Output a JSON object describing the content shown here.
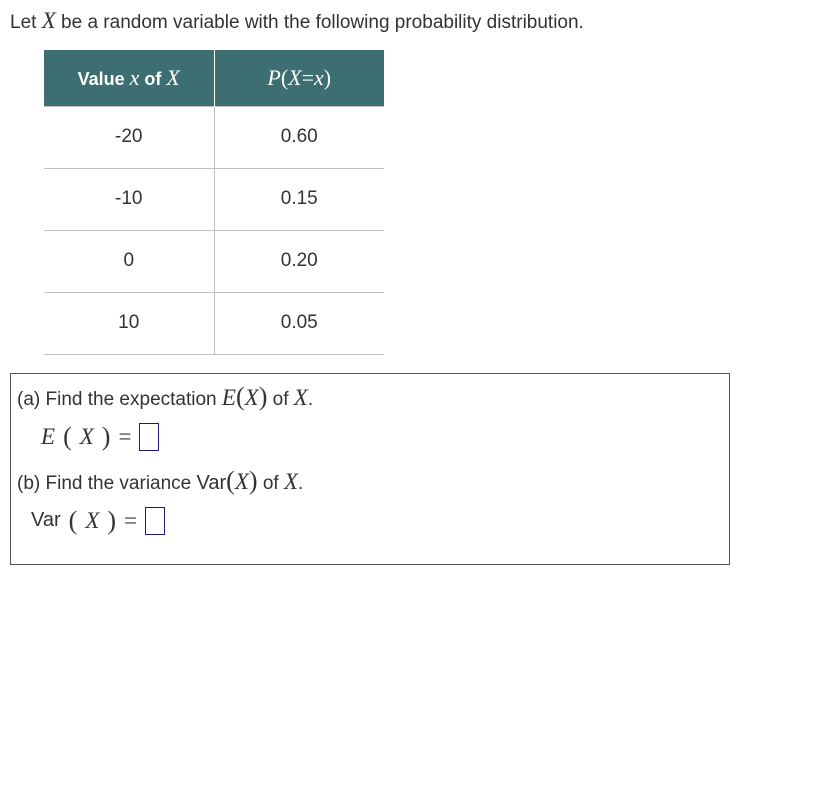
{
  "intro": {
    "prefix": "Let ",
    "var": "X",
    "suffix": " be a random variable with the following probability distribution."
  },
  "table": {
    "header": {
      "col1_pre": "Value ",
      "col1_var_x": "x",
      "col1_of": " of ",
      "col1_var_X": "X",
      "col2_P": "P",
      "col2_open": "(",
      "col2_X": "X",
      "col2_eq": "=",
      "col2_x": "x",
      "col2_close": ")"
    },
    "rows": [
      {
        "x": "-20",
        "p": "0.60"
      },
      {
        "x": "-10",
        "p": "0.15"
      },
      {
        "x": "0",
        "p": "0.20"
      },
      {
        "x": "10",
        "p": "0.05"
      }
    ]
  },
  "parts": {
    "a": {
      "label": "(a) Find the expectation ",
      "func_E": "E",
      "open": "(",
      "var_X": "X",
      "close": ")",
      "of": " of ",
      "of_var": "X",
      "dot": ".",
      "eq_E": "E",
      "eq_open": "(",
      "eq_X": "X",
      "eq_close": ")",
      "eq_sign": "="
    },
    "b": {
      "label": "(b) Find the variance ",
      "var_word": "Var",
      "open": "(",
      "var_X": "X",
      "close": ")",
      "of": " of ",
      "of_var": "X",
      "dot": ".",
      "eq_Var": "Var",
      "eq_open": "(",
      "eq_X": "X",
      "eq_close": ")",
      "eq_sign": "="
    }
  },
  "chart_data": {
    "type": "table",
    "title": "Probability distribution of X",
    "columns": [
      "x",
      "P(X=x)"
    ],
    "rows": [
      [
        -20,
        0.6
      ],
      [
        -10,
        0.15
      ],
      [
        0,
        0.2
      ],
      [
        10,
        0.05
      ]
    ]
  }
}
